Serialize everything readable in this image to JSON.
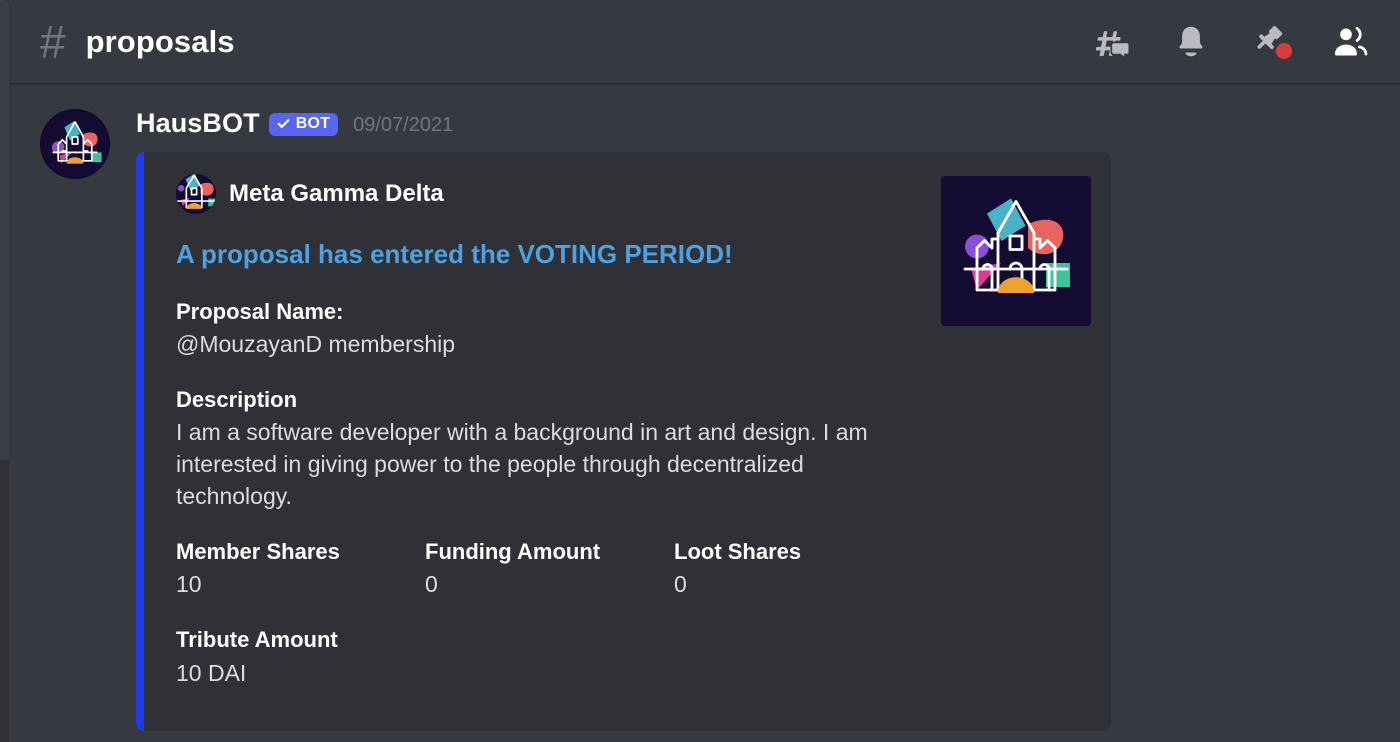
{
  "header": {
    "hash_glyph": "#",
    "channel_name": "proposals",
    "actions": [
      {
        "name": "threads-icon",
        "label": "Threads"
      },
      {
        "name": "bell-icon",
        "label": "Notification Settings"
      },
      {
        "name": "pin-icon",
        "label": "Pinned Messages"
      },
      {
        "name": "members-icon",
        "label": "Member List"
      }
    ]
  },
  "message": {
    "author": "HausBOT",
    "bot_tag": "BOT",
    "bot_check": "✓",
    "timestamp": "09/07/2021",
    "avatar_alt": "Meta Gamma Delta castle logo"
  },
  "embed": {
    "accent_color": "#1f3bea",
    "background_color": "#2f3136",
    "author_name": "Meta Gamma Delta",
    "title": "A proposal has entered the VOTING PERIOD!",
    "title_color": "#4ea1e0",
    "fields": {
      "proposal_name_label": "Proposal Name:",
      "proposal_name_value": "@MouzayanD membership",
      "description_label": "Description",
      "description_value": "I am a software developer with a background in art and design. I am interested in giving power to the people through decentralized technology.",
      "member_shares_label": "Member Shares",
      "member_shares_value": "10",
      "funding_amount_label": "Funding Amount",
      "funding_amount_value": "0",
      "loot_shares_label": "Loot Shares",
      "loot_shares_value": "0",
      "tribute_amount_label": "Tribute Amount",
      "tribute_amount_value": "10 DAI"
    },
    "thumbnail_alt": "Meta Gamma Delta castle logo"
  }
}
